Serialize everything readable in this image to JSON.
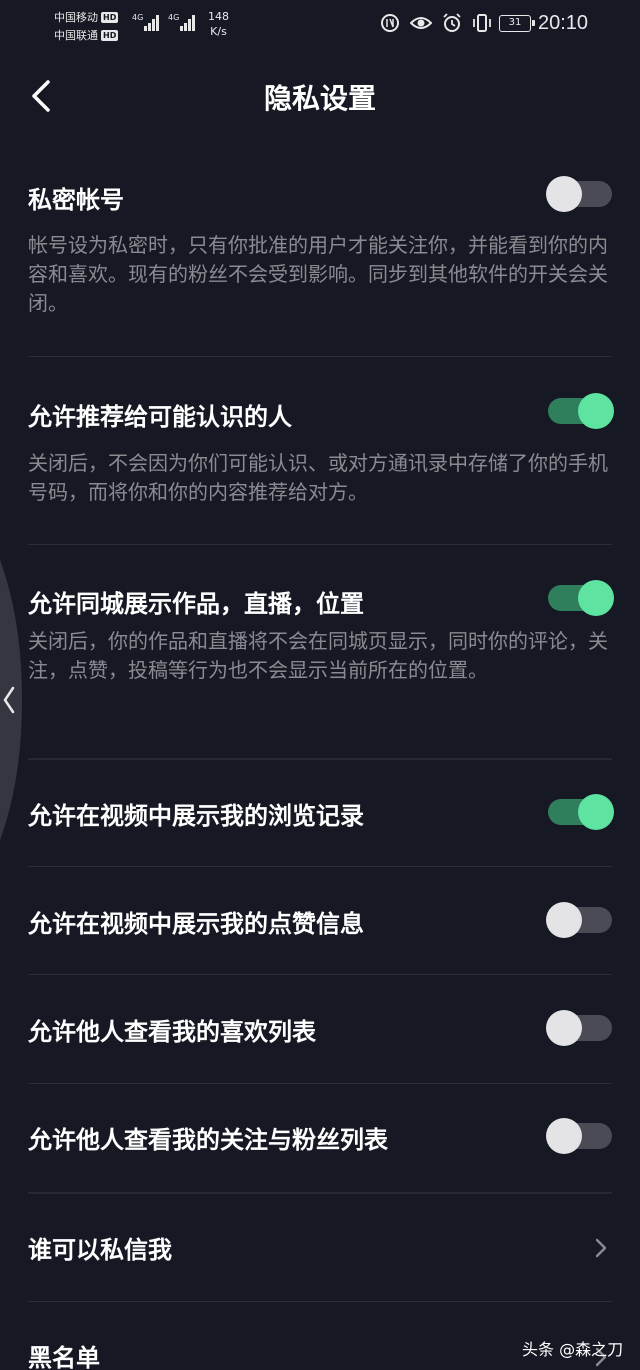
{
  "status_bar": {
    "carrier_1": "中国移动",
    "carrier_2": "中国联通",
    "hd": "HD",
    "net_speed_value": "148",
    "net_speed_unit": "K/s",
    "battery": "31",
    "time": "20:10"
  },
  "header": {
    "title": "隐私设置"
  },
  "settings": [
    {
      "title": "私密帐号",
      "desc": "帐号设为私密时，只有你批准的用户才能关注你，并能看到你的内容和喜欢。现有的粉丝不会受到影响。同步到其他软件的开关会关闭。",
      "enabled": false
    },
    {
      "title": "允许推荐给可能认识的人",
      "desc": "关闭后，不会因为你们可能认识、或对方通讯录中存储了你的手机号码，而将你和你的内容推荐给对方。",
      "enabled": true
    },
    {
      "title": "允许同城展示作品，直播，位置",
      "desc": "关闭后，你的作品和直播将不会在同城页显示，同时你的评论，关注，点赞，投稿等行为也不会显示当前所在的位置。",
      "enabled": true
    },
    {
      "title": "允许在视频中展示我的浏览记录",
      "enabled": true
    },
    {
      "title": "允许在视频中展示我的点赞信息",
      "enabled": false
    },
    {
      "title": "允许他人查看我的喜欢列表",
      "enabled": false
    },
    {
      "title": "允许他人查看我的关注与粉丝列表",
      "enabled": false
    }
  ],
  "links": [
    {
      "title": "谁可以私信我"
    },
    {
      "title": "黑名单"
    }
  ],
  "watermark": "头条 @森之刀",
  "colors": {
    "background": "#161823",
    "toggle_on": "#5ee3a1",
    "toggle_on_track": "#2f7f5d",
    "toggle_off_knob": "#e4e4e6",
    "toggle_off_track": "#4a4b54",
    "desc_text": "#8a8b91"
  }
}
